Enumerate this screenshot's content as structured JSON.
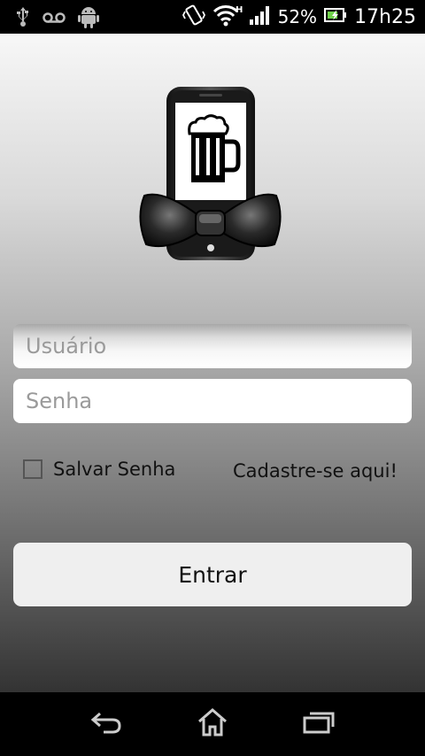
{
  "status_bar": {
    "battery": "52%",
    "time": "17h25",
    "icons": [
      "usb-icon",
      "voicemail-icon",
      "android-icon",
      "vibrate-icon",
      "wifi-icon",
      "signal-icon",
      "battery-charging-icon"
    ]
  },
  "login": {
    "username_placeholder": "Usuário",
    "password_placeholder": "Senha",
    "remember_label": "Salvar Senha",
    "signup_link": "Cadastre-se aqui!",
    "submit_label": "Entrar"
  },
  "nav_bar": {
    "icons": [
      "back-icon",
      "home-icon",
      "recent-apps-icon"
    ]
  }
}
